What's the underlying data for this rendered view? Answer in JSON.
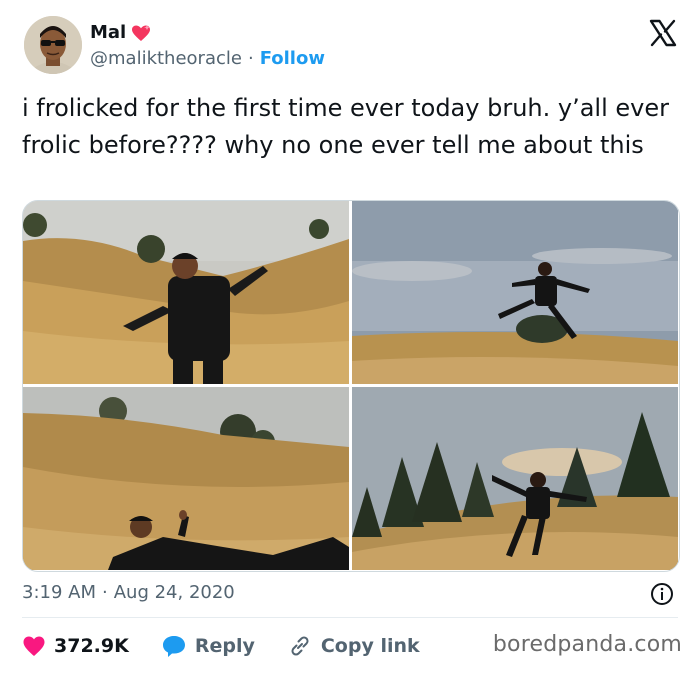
{
  "author": {
    "display_name": "Mal",
    "handle": "@maliktheoracle",
    "separator": "·",
    "follow_label": "Follow",
    "name_emoji": "sparkling-heart-icon"
  },
  "tweet": {
    "text": "i frolicked for the first time ever today bruh. y’all ever frolic before???? why no one ever tell me about this",
    "time": "3:19 AM",
    "separator": "·",
    "date": "Aug 24, 2020"
  },
  "media": {
    "photos": [
      "photo-man-arms-spread-on-hillside",
      "photo-man-leaping-on-hilltop",
      "photo-man-lying-in-grass",
      "photo-man-spinning-among-trees"
    ]
  },
  "actions": {
    "likes_count": "372.9K",
    "reply_label": "Reply",
    "copy_link_label": "Copy link"
  },
  "watermark": "boredpanda.com",
  "colors": {
    "brand_blue": "#1d9bf0",
    "like_pink": "#f91880",
    "text_primary": "#0f1419",
    "text_secondary": "#536471"
  }
}
